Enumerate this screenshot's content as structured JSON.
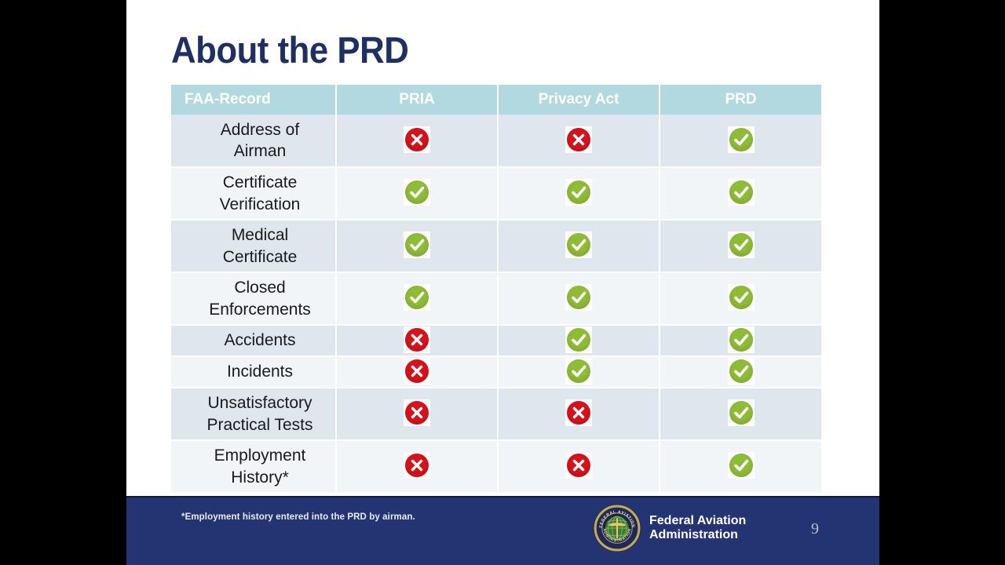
{
  "slide": {
    "title": "About the PRD",
    "page_number": "9"
  },
  "colors": {
    "title": "#1f2f63",
    "header_bg": "#b2d8e0",
    "row_odd": "#dfe6ed",
    "row_even": "#f1f5f8",
    "footer_bg": "#243371",
    "yes_badge": "#8fbc36",
    "no_badge": "#d8121a"
  },
  "table": {
    "columns": [
      "FAA-Record",
      "PRIA",
      "Privacy Act",
      "PRD"
    ],
    "rows": [
      {
        "label": "Address of Airman",
        "lines": [
          "Address of",
          "Airman"
        ],
        "tall": true,
        "values": [
          "no",
          "no",
          "yes"
        ]
      },
      {
        "label": "Certificate Verification",
        "lines": [
          "Certificate",
          "Verification"
        ],
        "tall": true,
        "values": [
          "yes",
          "yes",
          "yes"
        ]
      },
      {
        "label": "Medical Certificate",
        "lines": [
          "Medical",
          "Certificate"
        ],
        "tall": true,
        "values": [
          "yes",
          "yes",
          "yes"
        ]
      },
      {
        "label": "Closed Enforcements",
        "lines": [
          "Closed",
          "Enforcements"
        ],
        "tall": true,
        "values": [
          "yes",
          "yes",
          "yes"
        ]
      },
      {
        "label": "Accidents",
        "lines": [
          "Accidents"
        ],
        "tall": false,
        "values": [
          "no",
          "yes",
          "yes"
        ]
      },
      {
        "label": "Incidents",
        "lines": [
          "Incidents"
        ],
        "tall": false,
        "values": [
          "no",
          "yes",
          "yes"
        ]
      },
      {
        "label": "Unsatisfactory Practical Tests",
        "lines": [
          "Unsatisfactory",
          "Practical Tests"
        ],
        "tall": true,
        "values": [
          "no",
          "no",
          "yes"
        ]
      },
      {
        "label": "Employment History*",
        "lines": [
          "Employment",
          "History*"
        ],
        "tall": true,
        "values": [
          "no",
          "no",
          "yes"
        ]
      }
    ]
  },
  "footer": {
    "footnote": "*Employment history entered into the PRD by airman.",
    "agency_line1": "Federal Aviation",
    "agency_line2": "Administration",
    "seal_top_text": "FEDERAL AVIATION",
    "seal_bottom_text": "ADMINISTRATION"
  },
  "icons": {
    "yes": "check-circle-icon",
    "no": "x-circle-icon",
    "seal": "faa-seal-icon"
  }
}
